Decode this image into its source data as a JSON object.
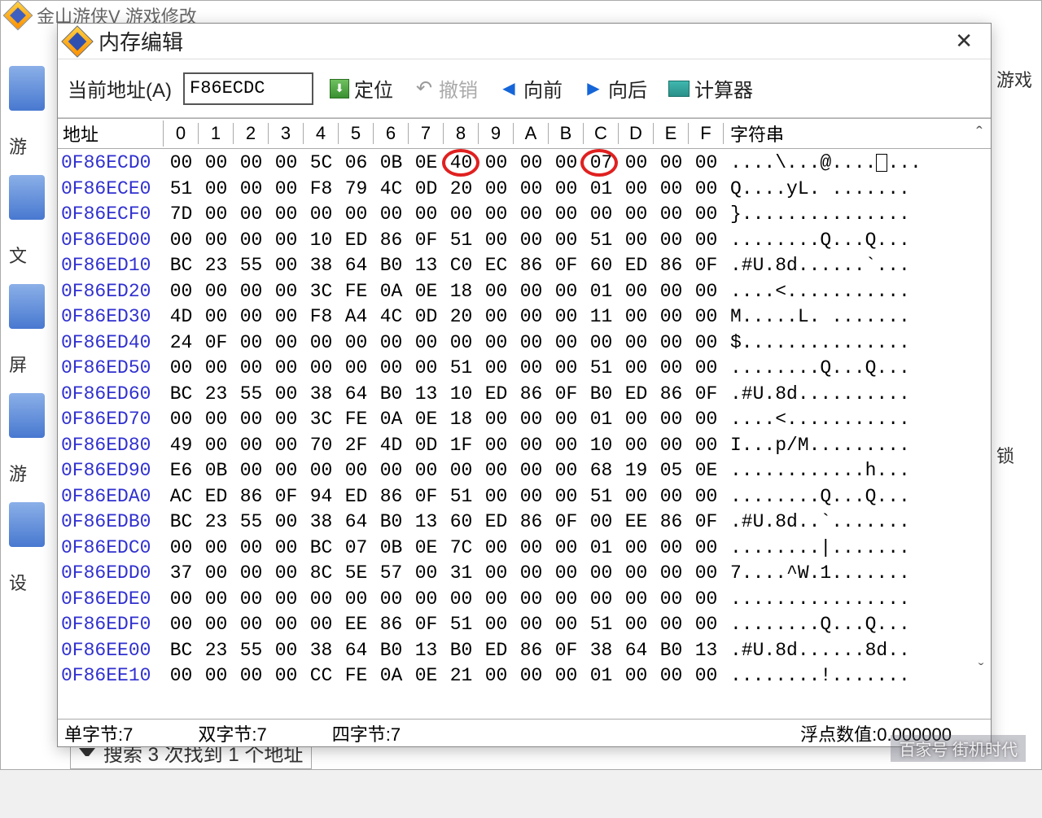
{
  "bg_window": {
    "title": "金山游侠V    游戏修改",
    "sidebar_labels": [
      "游",
      "文",
      "屏",
      "游",
      "设"
    ],
    "right_labels": [
      "游戏",
      "锁"
    ],
    "search_text": "搜索 3 次找到 1 个地址"
  },
  "dialog": {
    "title": "内存编辑",
    "toolbar": {
      "addr_label": "当前地址(A)",
      "addr_value": "F86ECDC",
      "locate": "定位",
      "undo": "撤销",
      "prev": "向前",
      "next": "向后",
      "calc": "计算器"
    },
    "headers": {
      "addr": "地址",
      "bytes": [
        "0",
        "1",
        "2",
        "3",
        "4",
        "5",
        "6",
        "7",
        "8",
        "9",
        "A",
        "B",
        "C",
        "D",
        "E",
        "F"
      ],
      "str": "字符串"
    },
    "rows": [
      {
        "addr": "0F86ECD0",
        "b": [
          "00",
          "00",
          "00",
          "00",
          "5C",
          "06",
          "0B",
          "0E",
          "40",
          "00",
          "00",
          "00",
          "07",
          "00",
          "00",
          "00"
        ],
        "s": "....\\...@......."
      },
      {
        "addr": "0F86ECE0",
        "b": [
          "51",
          "00",
          "00",
          "00",
          "F8",
          "79",
          "4C",
          "0D",
          "20",
          "00",
          "00",
          "00",
          "01",
          "00",
          "00",
          "00"
        ],
        "s": "Q....yL. ......."
      },
      {
        "addr": "0F86ECF0",
        "b": [
          "7D",
          "00",
          "00",
          "00",
          "00",
          "00",
          "00",
          "00",
          "00",
          "00",
          "00",
          "00",
          "00",
          "00",
          "00",
          "00"
        ],
        "s": "}..............."
      },
      {
        "addr": "0F86ED00",
        "b": [
          "00",
          "00",
          "00",
          "00",
          "10",
          "ED",
          "86",
          "0F",
          "51",
          "00",
          "00",
          "00",
          "51",
          "00",
          "00",
          "00"
        ],
        "s": "........Q...Q..."
      },
      {
        "addr": "0F86ED10",
        "b": [
          "BC",
          "23",
          "55",
          "00",
          "38",
          "64",
          "B0",
          "13",
          "C0",
          "EC",
          "86",
          "0F",
          "60",
          "ED",
          "86",
          "0F"
        ],
        "s": ".#U.8d......`..."
      },
      {
        "addr": "0F86ED20",
        "b": [
          "00",
          "00",
          "00",
          "00",
          "3C",
          "FE",
          "0A",
          "0E",
          "18",
          "00",
          "00",
          "00",
          "01",
          "00",
          "00",
          "00"
        ],
        "s": "....<..........."
      },
      {
        "addr": "0F86ED30",
        "b": [
          "4D",
          "00",
          "00",
          "00",
          "F8",
          "A4",
          "4C",
          "0D",
          "20",
          "00",
          "00",
          "00",
          "11",
          "00",
          "00",
          "00"
        ],
        "s": "M.....L. ......."
      },
      {
        "addr": "0F86ED40",
        "b": [
          "24",
          "0F",
          "00",
          "00",
          "00",
          "00",
          "00",
          "00",
          "00",
          "00",
          "00",
          "00",
          "00",
          "00",
          "00",
          "00"
        ],
        "s": "$..............."
      },
      {
        "addr": "0F86ED50",
        "b": [
          "00",
          "00",
          "00",
          "00",
          "00",
          "00",
          "00",
          "00",
          "51",
          "00",
          "00",
          "00",
          "51",
          "00",
          "00",
          "00"
        ],
        "s": "........Q...Q..."
      },
      {
        "addr": "0F86ED60",
        "b": [
          "BC",
          "23",
          "55",
          "00",
          "38",
          "64",
          "B0",
          "13",
          "10",
          "ED",
          "86",
          "0F",
          "B0",
          "ED",
          "86",
          "0F"
        ],
        "s": ".#U.8d.........."
      },
      {
        "addr": "0F86ED70",
        "b": [
          "00",
          "00",
          "00",
          "00",
          "3C",
          "FE",
          "0A",
          "0E",
          "18",
          "00",
          "00",
          "00",
          "01",
          "00",
          "00",
          "00"
        ],
        "s": "....<..........."
      },
      {
        "addr": "0F86ED80",
        "b": [
          "49",
          "00",
          "00",
          "00",
          "70",
          "2F",
          "4D",
          "0D",
          "1F",
          "00",
          "00",
          "00",
          "10",
          "00",
          "00",
          "00"
        ],
        "s": "I...p/M........."
      },
      {
        "addr": "0F86ED90",
        "b": [
          "E6",
          "0B",
          "00",
          "00",
          "00",
          "00",
          "00",
          "00",
          "00",
          "00",
          "00",
          "00",
          "68",
          "19",
          "05",
          "0E"
        ],
        "s": "............h..."
      },
      {
        "addr": "0F86EDA0",
        "b": [
          "AC",
          "ED",
          "86",
          "0F",
          "94",
          "ED",
          "86",
          "0F",
          "51",
          "00",
          "00",
          "00",
          "51",
          "00",
          "00",
          "00"
        ],
        "s": "........Q...Q..."
      },
      {
        "addr": "0F86EDB0",
        "b": [
          "BC",
          "23",
          "55",
          "00",
          "38",
          "64",
          "B0",
          "13",
          "60",
          "ED",
          "86",
          "0F",
          "00",
          "EE",
          "86",
          "0F"
        ],
        "s": ".#U.8d..`......."
      },
      {
        "addr": "0F86EDC0",
        "b": [
          "00",
          "00",
          "00",
          "00",
          "BC",
          "07",
          "0B",
          "0E",
          "7C",
          "00",
          "00",
          "00",
          "01",
          "00",
          "00",
          "00"
        ],
        "s": "........|......."
      },
      {
        "addr": "0F86EDD0",
        "b": [
          "37",
          "00",
          "00",
          "00",
          "8C",
          "5E",
          "57",
          "00",
          "31",
          "00",
          "00",
          "00",
          "00",
          "00",
          "00",
          "00"
        ],
        "s": "7....^W.1......."
      },
      {
        "addr": "0F86EDE0",
        "b": [
          "00",
          "00",
          "00",
          "00",
          "00",
          "00",
          "00",
          "00",
          "00",
          "00",
          "00",
          "00",
          "00",
          "00",
          "00",
          "00"
        ],
        "s": "................"
      },
      {
        "addr": "0F86EDF0",
        "b": [
          "00",
          "00",
          "00",
          "00",
          "00",
          "EE",
          "86",
          "0F",
          "51",
          "00",
          "00",
          "00",
          "51",
          "00",
          "00",
          "00"
        ],
        "s": "........Q...Q..."
      },
      {
        "addr": "0F86EE00",
        "b": [
          "BC",
          "23",
          "55",
          "00",
          "38",
          "64",
          "B0",
          "13",
          "B0",
          "ED",
          "86",
          "0F",
          "38",
          "64",
          "B0",
          "13"
        ],
        "s": ".#U.8d......8d.."
      },
      {
        "addr": "0F86EE10",
        "b": [
          "00",
          "00",
          "00",
          "00",
          "CC",
          "FE",
          "0A",
          "0E",
          "21",
          "00",
          "00",
          "00",
          "01",
          "00",
          "00",
          "00"
        ],
        "s": "........!......."
      }
    ],
    "status": {
      "single": "单字节:7",
      "double": "双字节:7",
      "quad": "四字节:7",
      "float": "浮点数值:0.000000"
    }
  },
  "watermark": "百家号    街机时代"
}
